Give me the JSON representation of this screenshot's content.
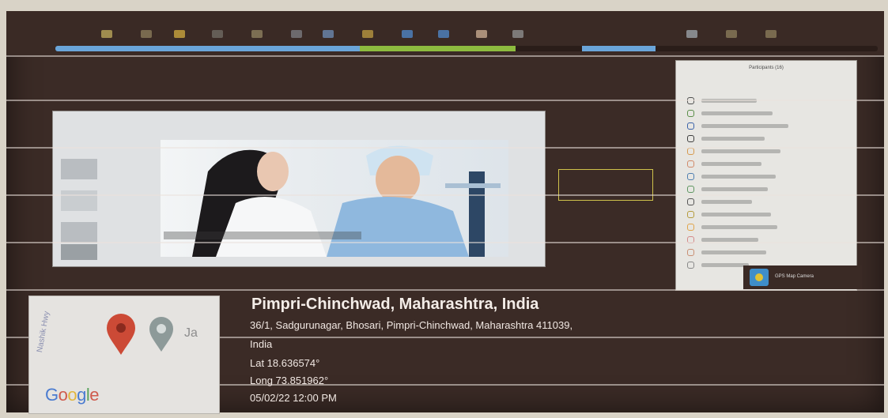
{
  "geotag": {
    "city": "Pimpri-Chinchwad, Maharashtra, India",
    "address_line1": "36/1, Sadgurunagar, Bhosari, Pimpri-Chinchwad, Maharashtra 411039,",
    "address_line2": "India",
    "latitude": "Lat 18.636574°",
    "longitude": "Long 73.851962°",
    "datetime": "05/02/22 12:00 PM"
  },
  "map": {
    "logo": "Google",
    "nearby_label": "Ja",
    "road_label": "Nashik Hwy",
    "pin_icons": [
      "map-pin-icon",
      "nearby-place-pin-icon"
    ]
  },
  "panel": {
    "title": "Participants (16)",
    "participant_count": 16
  },
  "camera": {
    "label": "GPS Map Camera"
  },
  "meeting_progress": {
    "fill_fraction": 0.52
  },
  "colors": {
    "screen_bg": "#3b2b26",
    "progress_blue": "#6aa5d9",
    "progress_green": "#8dbb3f",
    "pin_red": "#cc4a36",
    "pin_gray": "#8d9a99",
    "highlight_box": "#cfc24b"
  }
}
